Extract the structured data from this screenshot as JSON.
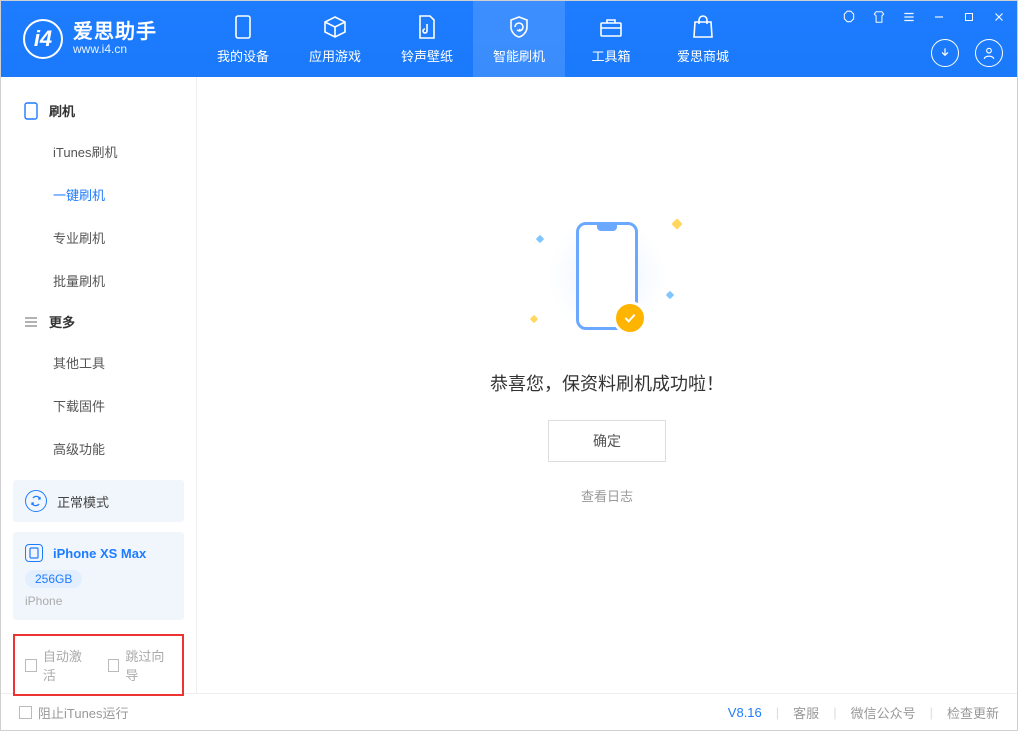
{
  "brand": {
    "name": "爱思助手",
    "url": "www.i4.cn"
  },
  "tabs": {
    "device": "我的设备",
    "apps": "应用游戏",
    "ring": "铃声壁纸",
    "flash": "智能刷机",
    "tools": "工具箱",
    "store": "爱思商城"
  },
  "sidebar": {
    "group1": "刷机",
    "items1": {
      "itunes": "iTunes刷机",
      "oneclick": "一键刷机",
      "pro": "专业刷机",
      "batch": "批量刷机"
    },
    "group2": "更多",
    "items2": {
      "other": "其他工具",
      "firmware": "下载固件",
      "advanced": "高级功能"
    }
  },
  "mode_card": {
    "label": "正常模式"
  },
  "device": {
    "name": "iPhone XS Max",
    "capacity": "256GB",
    "model": "iPhone"
  },
  "options": {
    "auto_activate": "自动激活",
    "skip_guide": "跳过向导"
  },
  "main": {
    "success": "恭喜您，保资料刷机成功啦！",
    "ok": "确定",
    "view_log": "查看日志"
  },
  "footer": {
    "block_itunes": "阻止iTunes运行",
    "version": "V8.16",
    "support": "客服",
    "wechat": "微信公众号",
    "update": "检查更新"
  }
}
